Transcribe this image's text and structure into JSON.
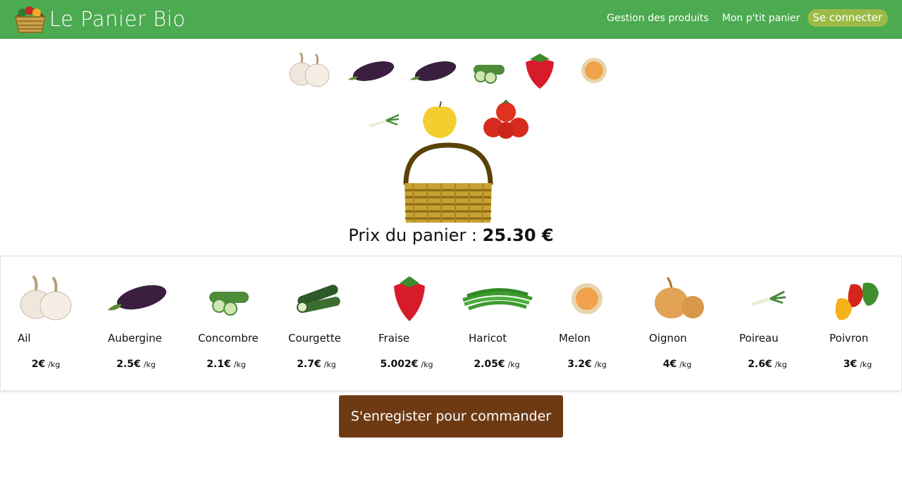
{
  "brand": {
    "name": "Le Panier Bio"
  },
  "nav": {
    "products_label": "Gestion des produits",
    "cart_label": "Mon p'tit panier",
    "login_label": "Se connecter"
  },
  "basket": {
    "price_label": "Prix du panier : ",
    "price_value": "25.30 €",
    "row1": [
      "garlic",
      "eggplant",
      "eggplant",
      "cucumber",
      "strawberry",
      "melon"
    ],
    "row2": [
      "leek",
      "apple",
      "tomato"
    ]
  },
  "products": [
    {
      "name": "Ail",
      "price": "2€",
      "unit": "/kg",
      "icon": "garlic"
    },
    {
      "name": "Aubergine",
      "price": "2.5€",
      "unit": "/kg",
      "icon": "eggplant"
    },
    {
      "name": "Concombre",
      "price": "2.1€",
      "unit": "/kg",
      "icon": "cucumber"
    },
    {
      "name": "Courgette",
      "price": "2.7€",
      "unit": "/kg",
      "icon": "zucchini"
    },
    {
      "name": "Fraise",
      "price": "5.002€",
      "unit": "/kg",
      "icon": "strawberry"
    },
    {
      "name": "Haricot",
      "price": "2.05€",
      "unit": "/kg",
      "icon": "green-beans"
    },
    {
      "name": "Melon",
      "price": "3.2€",
      "unit": "/kg",
      "icon": "melon"
    },
    {
      "name": "Oignon",
      "price": "4€",
      "unit": "/kg",
      "icon": "onion"
    },
    {
      "name": "Poireau",
      "price": "2.6€",
      "unit": "/kg",
      "icon": "leek"
    },
    {
      "name": "Poivron",
      "price": "3€",
      "unit": "/kg",
      "icon": "pepper"
    }
  ],
  "cta": {
    "register_label": "S'enregister pour commander"
  },
  "colors": {
    "navbar": "#4caa50",
    "login": "#9abc47",
    "cta": "#6e3a14"
  }
}
